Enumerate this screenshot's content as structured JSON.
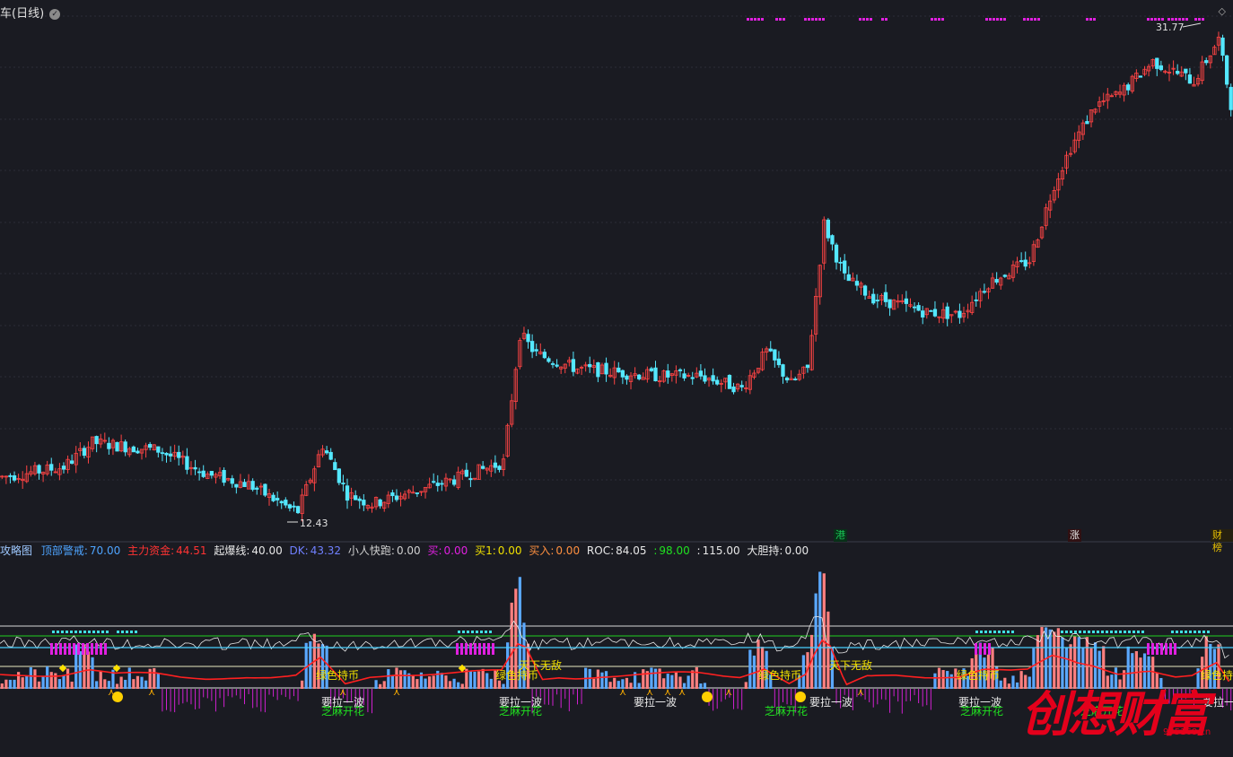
{
  "title": "车(日线)",
  "badge": "✓",
  "max_label": "31.77",
  "min_label": "12.43",
  "events": [
    {
      "text": "港",
      "color": "#19c455"
    },
    {
      "text": "涨",
      "color": "#e8e8e8"
    },
    {
      "text": "财榜",
      "color": "#e8c000"
    }
  ],
  "indicator": [
    {
      "label": "攻略图",
      "value": "",
      "color": "#9ec8ff"
    },
    {
      "label": "顶部警戒:",
      "value": "70.00",
      "color": "#4ea4ff"
    },
    {
      "label": "主力资金:",
      "value": "44.51",
      "color": "#ff3333"
    },
    {
      "label": "起爆线:",
      "value": "40.00",
      "color": "#e8e8e8"
    },
    {
      "label": "DK:",
      "value": "43.32",
      "color": "#7080ff"
    },
    {
      "label": "小人快跑:",
      "value": "0.00",
      "color": "#d0d0d0"
    },
    {
      "label": "买:",
      "value": "0.00",
      "color": "#e020e0"
    },
    {
      "label": "买1:",
      "value": "0.00",
      "color": "#f0e000"
    },
    {
      "label": "买入:",
      "value": "0.00",
      "color": "#ff9040"
    },
    {
      "label": "ROC:",
      "value": "84.05",
      "color": "#e8e8e8"
    },
    {
      "label": ":",
      "value": "98.00",
      "color": "#20e020"
    },
    {
      "label": ":",
      "value": "115.00",
      "color": "#e8e8e8"
    },
    {
      "label": "大胆持:",
      "value": "0.00",
      "color": "#e8e8e8"
    }
  ],
  "labels": {
    "green_hold": "绿色持币",
    "invincible": "天下无敌",
    "pull_wave": "要拉一波",
    "sesame": "芝麻开花"
  },
  "watermark": "创想财富",
  "watermark_url": "995168.cn",
  "chart_data": {
    "type": "candlestick",
    "price_range": [
      12.43,
      31.77
    ],
    "max": 31.77,
    "min": 12.43,
    "colors": {
      "up": "#ff4444",
      "down": "#54e8ff",
      "bg": "#1a1b22",
      "grid": "#2c2e38"
    }
  }
}
